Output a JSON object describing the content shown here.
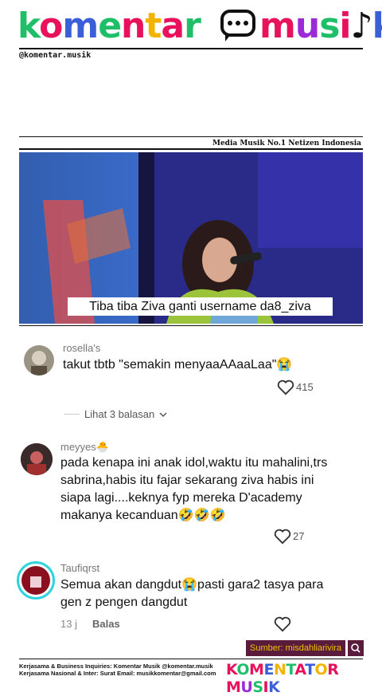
{
  "header": {
    "logo_komentar": "komentar",
    "logo_musik": "MUSIK",
    "handle": "@komentar.musik",
    "tagline": "Media Musik No.1 Netizen Indonesia"
  },
  "video": {
    "caption": "Tiba tiba Ziva ganti username da8_ziva"
  },
  "comments": [
    {
      "username": "rosella's",
      "text": "takut tbtb \"semakin menyaaAAaaLaa\"😭",
      "likes": "415"
    },
    {
      "username": "meyyes🐣",
      "text": "pada kenapa ini anak idol,waktu itu mahalini,trs sabrina,habis itu fajar sekarang ziva habis ini siapa lagi....keknya fyp mereka D'academy makanya kecanduan🤣🤣🤣",
      "likes": "27"
    },
    {
      "username": "Taufiqrst",
      "text": "Semua akan dangdut😭pasti gara2 tasya para gen z pengen dangdut",
      "time": "13 j",
      "reply_label": "Balas"
    }
  ],
  "replies_toggle": "Lihat 3 balasan",
  "source": "Sumber: misdahliarivira",
  "footer": {
    "line1": "Kerjasama & Business Inquiries: Komentar Musik @komentar.musik",
    "line2": "Kerjasama Nasional & Inter: Surat Email: musikkomentar@gmail.com",
    "logo": "KOMENTATOR MUSIK"
  },
  "icons": {
    "heart": "heart-icon",
    "chevron": "chevron-down-icon",
    "search": "search-icon",
    "bubble": "chat-bubble-icon"
  },
  "colors": {
    "source_bg": "#5a1c3c",
    "source_text": "#f2c200",
    "avatar_ring": "#2fd3e0"
  }
}
